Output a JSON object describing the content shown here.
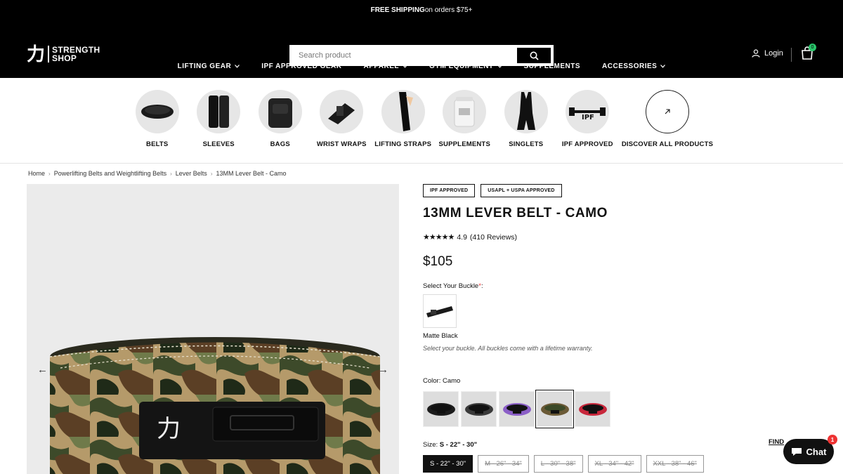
{
  "announcement": {
    "bold": "FREE SHIPPING",
    "rest": " on orders $75+"
  },
  "logo": {
    "glyph": "力",
    "line1": "STRENGTH",
    "line2": "SHOP"
  },
  "search": {
    "placeholder": "Search product"
  },
  "account": {
    "login_label": "Login"
  },
  "cart": {
    "count": "0"
  },
  "nav": {
    "items": [
      {
        "label": "LIFTING GEAR",
        "dropdown": true
      },
      {
        "label": "IPF APPROVED GEAR",
        "dropdown": false
      },
      {
        "label": "APPAREL",
        "dropdown": true
      },
      {
        "label": "GYM EQUIPMENT",
        "dropdown": true
      },
      {
        "label": "SUPPLEMENTS",
        "dropdown": false
      },
      {
        "label": "ACCESSORIES",
        "dropdown": true
      }
    ]
  },
  "categories": [
    {
      "label": "BELTS"
    },
    {
      "label": "SLEEVES"
    },
    {
      "label": "BAGS"
    },
    {
      "label": "WRIST WRAPS"
    },
    {
      "label": "LIFTING STRAPS"
    },
    {
      "label": "SUPPLEMENTS"
    },
    {
      "label": "SINGLETS"
    },
    {
      "label": "IPF APPROVED"
    },
    {
      "label": "DISCOVER ALL PRODUCTS"
    }
  ],
  "breadcrumb": [
    "Home",
    "Powerlifting Belts and Weightlifting Belts",
    "Lever Belts",
    "13MM Lever Belt - Camo"
  ],
  "product": {
    "tags": [
      "IPF APPROVED",
      "USAPL + USPA APPROVED"
    ],
    "title": "13MM LEVER BELT - CAMO",
    "rating": "4.9",
    "reviews": "(410 Reviews)",
    "price": "$105",
    "buckle_label": "Select Your Buckle",
    "buckle_name": "Matte Black",
    "buckle_note": "Select your buckle. All buckles come with a lifetime warranty.",
    "color_label": "Color: Camo",
    "colors": [
      {
        "name": "black",
        "hex": "#1c1c1c"
      },
      {
        "name": "grey",
        "hex": "#3a3a3a"
      },
      {
        "name": "purple",
        "hex": "#8b5fc7"
      },
      {
        "name": "camo",
        "hex": "#5a5a3a",
        "selected": true
      },
      {
        "name": "red",
        "hex": "#c8283c"
      }
    ],
    "size_label_prefix": "Size:",
    "size_selected": "S - 22\" - 30\"",
    "sizes": [
      "S - 22\" - 30\"",
      "M - 26\" - 34\"",
      "L - 30\" - 38\"",
      "XL - 34\" - 42\"",
      "XXL - 38\" - 46\""
    ],
    "find_link": "FIND"
  },
  "chat": {
    "label": "Chat",
    "badge": "1"
  }
}
